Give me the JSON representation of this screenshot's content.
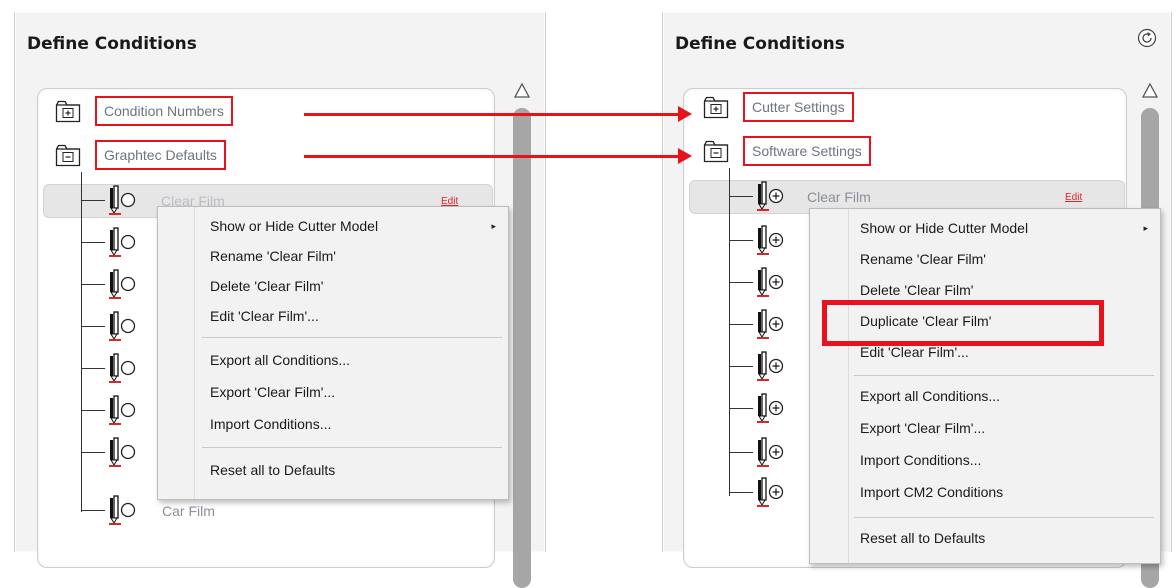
{
  "left_panel": {
    "title": "Define Conditions",
    "folders": [
      {
        "label": "Condition Numbers",
        "icon": "folder-plus-icon"
      },
      {
        "label": "Graphtec Defaults",
        "icon": "folder-minus-icon"
      }
    ],
    "selected_item": {
      "label": "Clear Film",
      "edit_label": "Edit"
    },
    "last_item": {
      "label": "Car Film"
    },
    "context_menu": {
      "items": [
        {
          "label": "Show or Hide Cutter Model",
          "has_submenu": true
        },
        {
          "label": "Rename 'Clear Film'"
        },
        {
          "label": "Delete 'Clear Film'"
        },
        {
          "label": "Edit 'Clear Film'..."
        },
        {
          "label": "Export all Conditions..."
        },
        {
          "label": "Export 'Clear Film'..."
        },
        {
          "label": "Import Conditions..."
        },
        {
          "label": "Reset all to Defaults"
        }
      ],
      "submenu_arrow": "▸"
    }
  },
  "right_panel": {
    "title": "Define Conditions",
    "refresh_icon": "refresh-icon",
    "folders": [
      {
        "label": "Cutter Settings",
        "icon": "folder-plus-icon"
      },
      {
        "label": "Software Settings",
        "icon": "folder-minus-icon"
      }
    ],
    "selected_item": {
      "label": "Clear Film",
      "edit_label": "Edit"
    },
    "context_menu": {
      "items": [
        {
          "label": "Show or Hide Cutter Model",
          "has_submenu": true
        },
        {
          "label": "Rename 'Clear Film'"
        },
        {
          "label": "Delete 'Clear Film'"
        },
        {
          "label": "Duplicate 'Clear Film'"
        },
        {
          "label": "Edit 'Clear Film'..."
        },
        {
          "label": "Export all Conditions..."
        },
        {
          "label": "Export 'Clear Film'..."
        },
        {
          "label": "Import Conditions..."
        },
        {
          "label": "Import CM2 Conditions"
        },
        {
          "label": "Reset all to Defaults"
        }
      ],
      "submenu_arrow": "▸"
    }
  },
  "colors": {
    "annotation_red": "#e8121c",
    "panel_bg": "#f3f3f3",
    "tree_label": "#6d7380",
    "scrollbar": "#a6a6a6"
  }
}
